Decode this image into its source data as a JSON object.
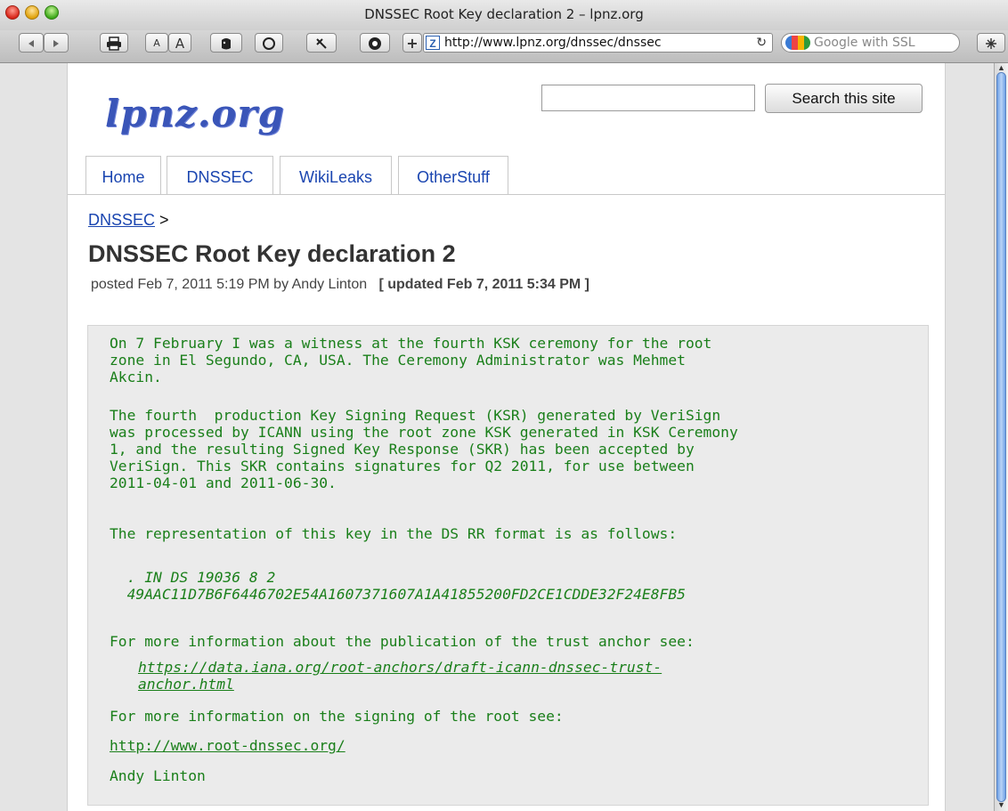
{
  "window": {
    "title": "DNSSEC Root Key declaration 2 – lpnz.org"
  },
  "toolbar": {
    "font_small": "A",
    "font_large": "A",
    "url": "http://www.lpnz.org/dnssec/dnssec",
    "search_placeholder": "Google with SSL"
  },
  "site": {
    "logo": "lpnz.org",
    "search_button": "Search this site",
    "search_value": ""
  },
  "tabs": [
    {
      "label": "Home"
    },
    {
      "label": "DNSSEC"
    },
    {
      "label": "WikiLeaks"
    },
    {
      "label": "OtherStuff"
    }
  ],
  "breadcrumb": {
    "link": "DNSSEC",
    "separator": ">"
  },
  "post": {
    "title": "DNSSEC Root Key declaration 2",
    "meta_posted": "posted Feb 7, 2011 5:19 PM by Andy Linton",
    "meta_updated": "[ updated Feb 7, 2011 5:34 PM ]",
    "para1": "On 7 February I was a witness at the fourth KSK ceremony for the root\nzone in El Segundo, CA, USA. The Ceremony Administrator was Mehmet\nAkcin.",
    "para2": "The fourth  production Key Signing Request (KSR) generated by VeriSign\nwas processed by ICANN using the root zone KSK generated in KSK Ceremony\n1, and the resulting Signed Key Response (SKR) has been accepted by\nVeriSign. This SKR contains signatures for Q2 2011, for use between\n2011-04-01 and 2011-06-30.",
    "para3": "The representation of this key in the DS RR format is as follows:",
    "ds_record": "  . IN DS 19036 8 2\n  49AAC11D7B6F6446702E54A1607371607A1A41855200FD2CE1CDDE32F24E8FB5",
    "para4": "For more information about the publication of the trust anchor see:",
    "trust_anchor_link": "https://data.iana.org/root-anchors/draft-icann-dnssec-trust-\nanchor.html",
    "para5": "For more information on the signing of the root see:",
    "root_link": "http://www.root-dnssec.org/",
    "signature": "Andy Linton"
  }
}
